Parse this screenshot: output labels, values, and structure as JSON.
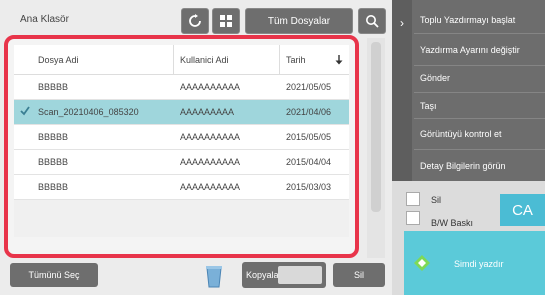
{
  "folder": {
    "title": "Ana Klasör"
  },
  "toolbar": {
    "all_documents_label": "Tüm Dosyalar",
    "refresh_icon": "refresh-icon",
    "grid_icon": "grid-icon",
    "search_icon": "search-icon"
  },
  "table": {
    "headers": {
      "name": "Dosya Adi",
      "user": "Kullanici Adi",
      "date": "Tarih"
    },
    "rows": [
      {
        "name": "BBBBB",
        "user": "AAAAAAAAAA",
        "date": "2021/05/05",
        "selected": false
      },
      {
        "name": "Scan_20210406_085320",
        "user": "AAAAAAAAA",
        "date": "2021/04/06",
        "selected": true
      },
      {
        "name": "BBBBB",
        "user": "AAAAAAAAAA",
        "date": "2015/05/05",
        "selected": false
      },
      {
        "name": "BBBBB",
        "user": "AAAAAAAAAA",
        "date": "2015/04/04",
        "selected": false
      },
      {
        "name": "BBBBB",
        "user": "AAAAAAAAAA",
        "date": "2015/03/03",
        "selected": false
      }
    ]
  },
  "bottom": {
    "select_all": "Tümünü Seç",
    "copies": "Kopyalar",
    "delete": "Sil"
  },
  "menu": {
    "items": [
      "Toplu Yazdırmayı başlat",
      "Yazdırma Ayarını değiştir",
      "Gönder",
      "Taşı",
      "Görüntüyü kontrol et",
      "Detay Bilgilerin görün"
    ]
  },
  "options": {
    "delete_label": "Sil",
    "bw_print_label": "B/W Baskı"
  },
  "actions": {
    "ca_label": "CA",
    "print_now": "Simdi yazdır"
  },
  "colors": {
    "highlight_border": "#e8344a",
    "selected_row": "#9fd6dc",
    "accent": "#5bcad9"
  }
}
